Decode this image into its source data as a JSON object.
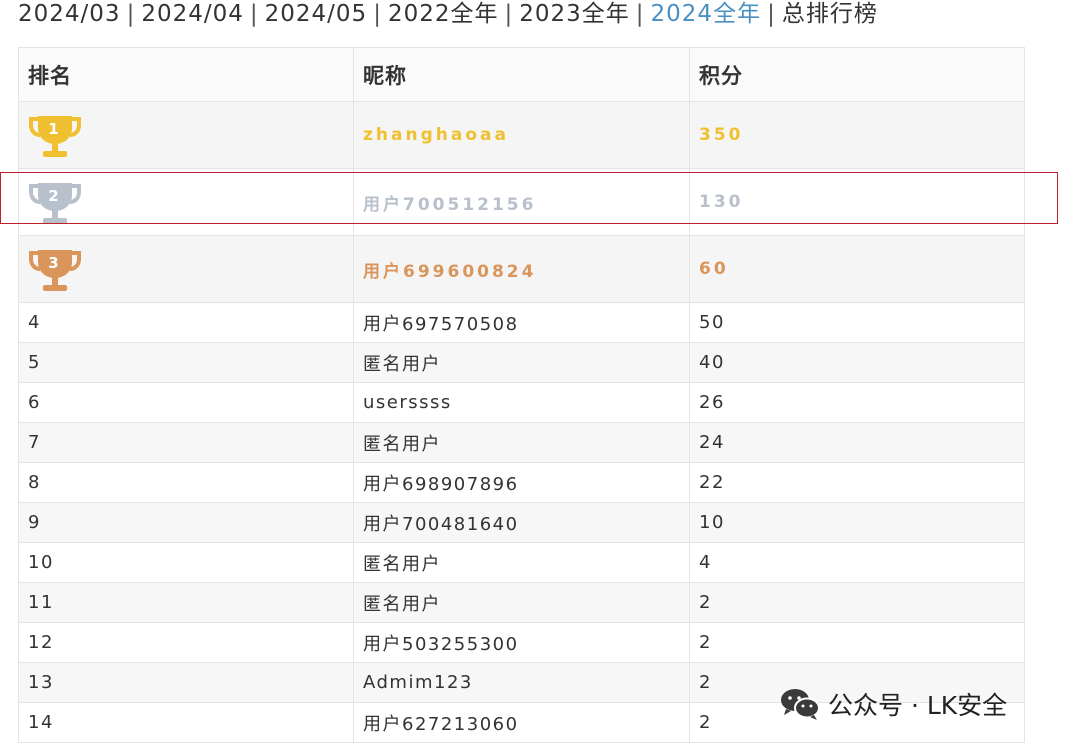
{
  "period_nav": {
    "separator": "|",
    "items": [
      {
        "label": "2024/03",
        "active": false
      },
      {
        "label": "2024/04",
        "active": false
      },
      {
        "label": "2024/05",
        "active": false
      },
      {
        "label": "2022全年",
        "active": false
      },
      {
        "label": "2023全年",
        "active": false
      },
      {
        "label": "2024全年",
        "active": true
      },
      {
        "label": "总排行榜",
        "active": false
      }
    ]
  },
  "table": {
    "headers": {
      "rank": "排名",
      "nickname": "昵称",
      "score": "积分"
    },
    "top_rows": [
      {
        "rank": "1",
        "nickname": "zhanghaoaa",
        "score": "350",
        "color": "#f0c030",
        "trophy": "gold-trophy-icon"
      },
      {
        "rank": "2",
        "nickname": "用户700512156",
        "score": "130",
        "color": "#b8c0cc",
        "trophy": "silver-trophy-icon"
      },
      {
        "rank": "3",
        "nickname": "用户699600824",
        "score": "60",
        "color": "#d9955a",
        "trophy": "bronze-trophy-icon"
      }
    ],
    "rows": [
      {
        "rank": "4",
        "nickname": "用户697570508",
        "score": "50"
      },
      {
        "rank": "5",
        "nickname": "匿名用户",
        "score": "40"
      },
      {
        "rank": "6",
        "nickname": "userssss",
        "score": "26"
      },
      {
        "rank": "7",
        "nickname": "匿名用户",
        "score": "24"
      },
      {
        "rank": "8",
        "nickname": "用户698907896",
        "score": "22"
      },
      {
        "rank": "9",
        "nickname": "用户700481640",
        "score": "10"
      },
      {
        "rank": "10",
        "nickname": "匿名用户",
        "score": "4"
      },
      {
        "rank": "11",
        "nickname": "匿名用户",
        "score": "2"
      },
      {
        "rank": "12",
        "nickname": "用户503255300",
        "score": "2"
      },
      {
        "rank": "13",
        "nickname": "Admim123",
        "score": "2"
      },
      {
        "rank": "14",
        "nickname": "用户627213060",
        "score": "2"
      }
    ]
  },
  "watermark": {
    "icon": "wechat-icon",
    "text": "公众号 · LK安全"
  },
  "colors": {
    "active_link": "#4a90c2",
    "highlight_border": "#c0202a"
  }
}
